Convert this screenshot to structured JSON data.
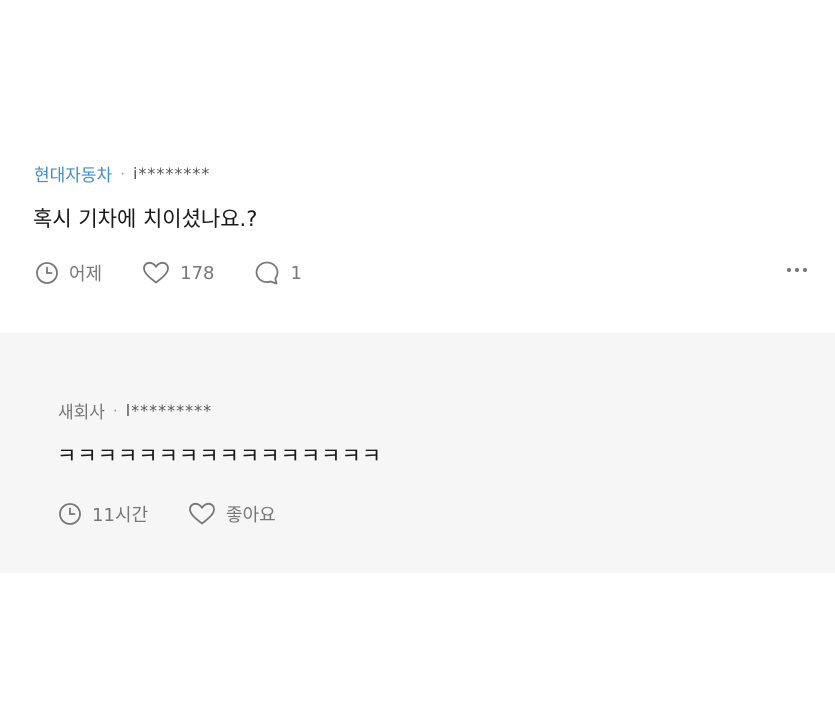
{
  "main_comment": {
    "company": "현대자동차",
    "separator": "·",
    "author": "i********",
    "text": "혹시 기차에 치이셨나요.?",
    "time": "어제",
    "likes": "178",
    "replies": "1"
  },
  "reply": {
    "company": "새회사",
    "separator": "·",
    "author": "l*********",
    "text": "ㅋㅋㅋㅋㅋㅋㅋㅋㅋㅋㅋㅋㅋㅋㅋㅋ",
    "time": "11시간",
    "like_label": "좋아요"
  },
  "colors": {
    "company_link": "#3d8fc4",
    "icon_grey": "#777777",
    "reply_background": "#f6f6f6"
  },
  "icons": [
    "clock-icon",
    "heart-icon",
    "speech-bubble-icon",
    "more-dots-icon"
  ]
}
